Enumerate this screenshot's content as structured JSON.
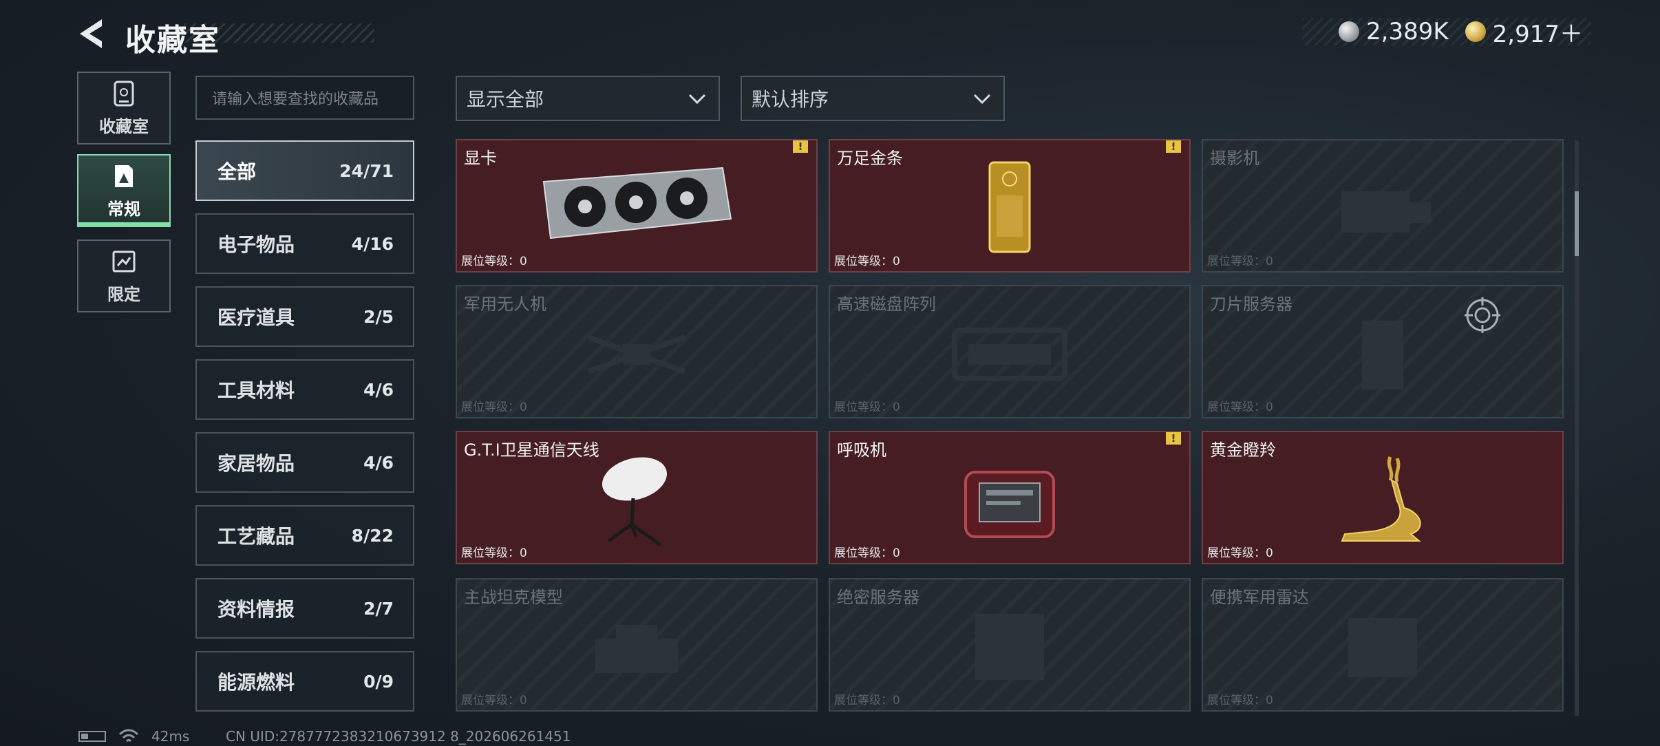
{
  "header": {
    "title": "收藏室",
    "currencies": [
      {
        "icon": "silver-coin-icon",
        "value": "2,389K"
      },
      {
        "icon": "gold-coin-icon",
        "value": "2,917＋"
      }
    ]
  },
  "nav": [
    {
      "label": "收藏室",
      "icon": "collection-room-icon",
      "active": false
    },
    {
      "label": "常规",
      "icon": "regular-collection-icon",
      "active": true
    },
    {
      "label": "限定",
      "icon": "limited-collection-icon",
      "active": false
    }
  ],
  "search": {
    "placeholder": "请输入想要查找的收藏品"
  },
  "filters": {
    "display": "显示全部",
    "sort": "默认排序"
  },
  "categories": [
    {
      "label": "全部",
      "count": "24/71",
      "active": true
    },
    {
      "label": "电子物品",
      "count": "4/16"
    },
    {
      "label": "医疗道具",
      "count": "2/5"
    },
    {
      "label": "工具材料",
      "count": "4/6"
    },
    {
      "label": "家居物品",
      "count": "4/6"
    },
    {
      "label": "工艺藏品",
      "count": "8/22"
    },
    {
      "label": "资料情报",
      "count": "2/7"
    },
    {
      "label": "能源燃料",
      "count": "0/9"
    }
  ],
  "display_level_label": "展位等级：",
  "items": [
    {
      "name": "显卡",
      "level": "0",
      "owned": true,
      "alert": true,
      "icon": "graphics-card-icon"
    },
    {
      "name": "万足金条",
      "level": "0",
      "owned": true,
      "alert": true,
      "icon": "gold-bar-icon"
    },
    {
      "name": "摄影机",
      "level": "0",
      "owned": false,
      "icon": "camera-icon"
    },
    {
      "name": "军用无人机",
      "level": "0",
      "owned": false,
      "icon": "drone-icon"
    },
    {
      "name": "高速磁盘阵列",
      "level": "0",
      "owned": false,
      "icon": "disk-array-icon"
    },
    {
      "name": "刀片服务器",
      "level": "0",
      "owned": false,
      "icon": "blade-server-icon"
    },
    {
      "name": "G.T.I卫星通信天线",
      "level": "0",
      "owned": true,
      "icon": "satellite-dish-icon"
    },
    {
      "name": "呼吸机",
      "level": "0",
      "owned": true,
      "alert": true,
      "icon": "ventilator-icon"
    },
    {
      "name": "黄金瞪羚",
      "level": "0",
      "owned": true,
      "icon": "golden-gazelle-icon"
    },
    {
      "name": "主战坦克模型",
      "level": "0",
      "owned": false,
      "icon": "tank-model-icon"
    },
    {
      "name": "绝密服务器",
      "level": "0",
      "owned": false,
      "icon": "secret-server-icon"
    },
    {
      "name": "便携军用雷达",
      "level": "0",
      "owned": false,
      "icon": "radar-icon"
    }
  ],
  "footer": {
    "ping": "42ms",
    "uid": "CN UID:2787772383210673912 8_202606261451"
  }
}
